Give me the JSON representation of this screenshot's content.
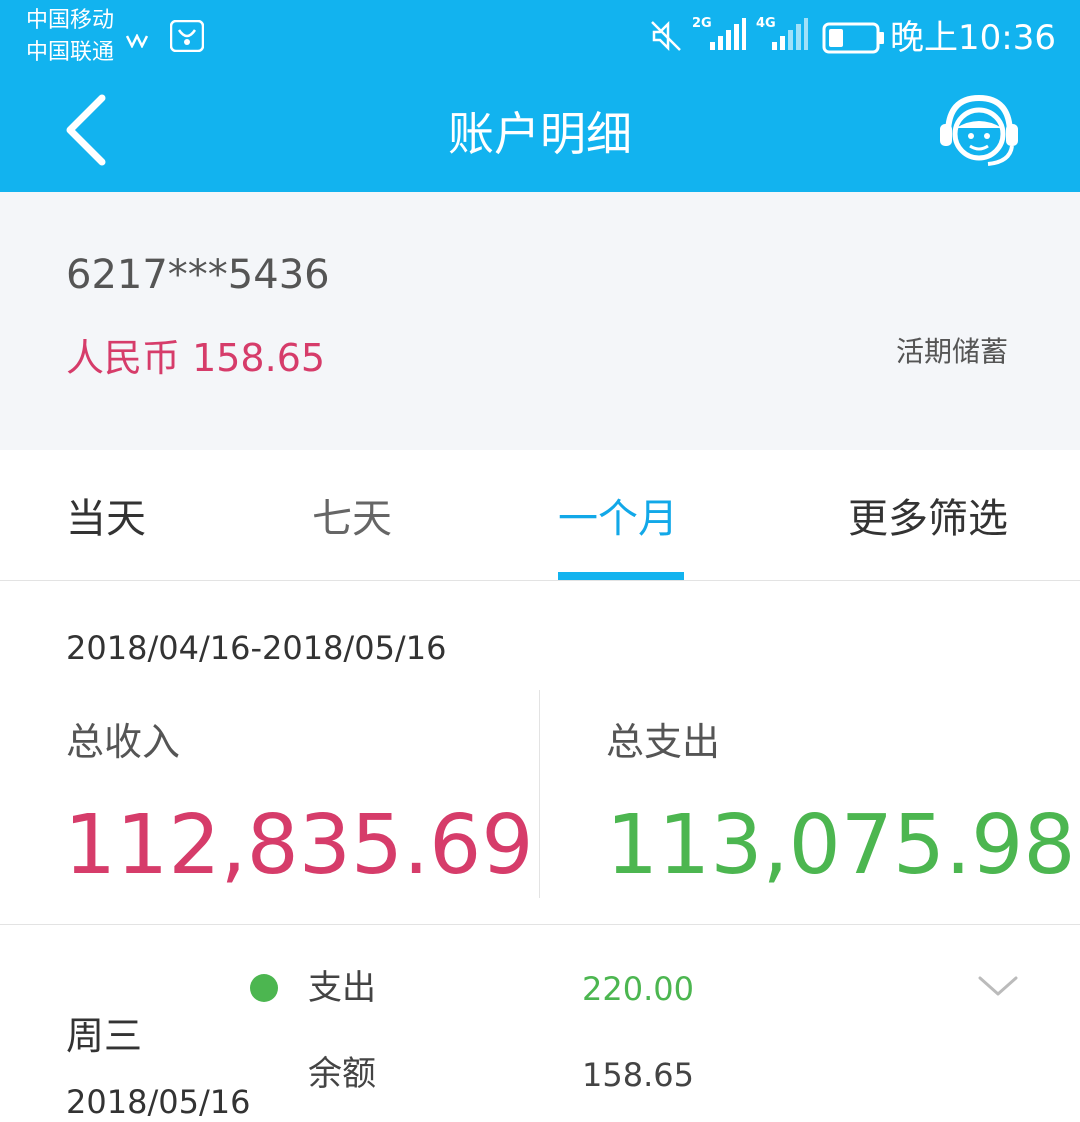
{
  "status_bar": {
    "carrier_1": "中国移动",
    "carrier_2": "中国联通",
    "network_1": "2G",
    "network_2": "4G",
    "time": "晚上10:36",
    "icons": [
      "app-icon",
      "app-icon",
      "mute-icon",
      "signal-icon",
      "signal-icon",
      "battery-icon"
    ]
  },
  "nav": {
    "title": "账户明细",
    "back_icon": "chevron-left-icon",
    "service_icon": "customer-service-icon"
  },
  "account": {
    "number": "6217***5436",
    "balance": "人民币 158.65",
    "type": "活期储蓄"
  },
  "tabs": [
    {
      "label": "当天"
    },
    {
      "label": "七天"
    },
    {
      "label": "一个月",
      "active": true
    },
    {
      "label": "更多筛选"
    }
  ],
  "summary": {
    "range": "2018/04/16-2018/05/16",
    "income_label": "总收入",
    "income_value": "112,835.69",
    "expense_label": "总支出",
    "expense_value": "113,075.98"
  },
  "transactions": [
    {
      "weekday": "周三",
      "date": "2018/05/16",
      "type_label": "支出",
      "amount": "220.00",
      "balance_label": "余额",
      "balance": "158.65"
    }
  ],
  "colors": {
    "header_blue": "#12b3ef",
    "income_red": "#d63c6a",
    "expense_green": "#4cb650",
    "active_tab": "#12a8e8"
  }
}
